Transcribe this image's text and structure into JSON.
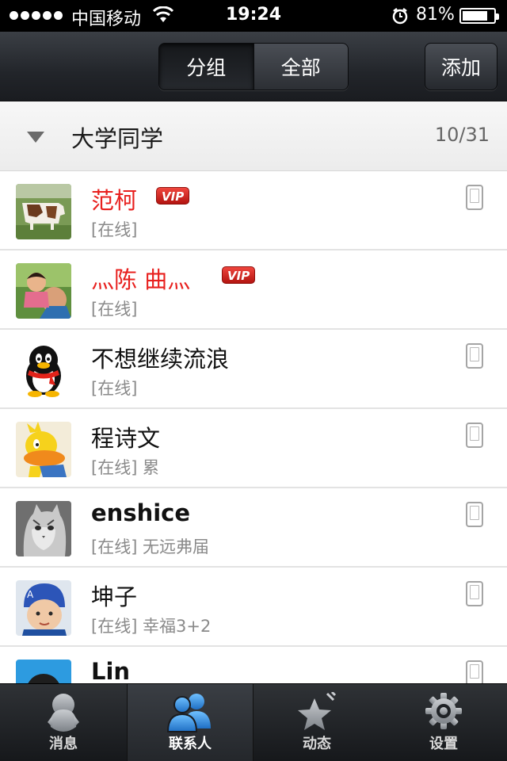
{
  "status_bar": {
    "carrier": "中国移动",
    "time": "19:24",
    "battery": "81%",
    "battery_level": 0.81
  },
  "nav": {
    "segments": [
      {
        "label": "分组",
        "selected": true
      },
      {
        "label": "全部",
        "selected": false
      }
    ],
    "add_label": "添加"
  },
  "group": {
    "name": "大学同学",
    "count": "10/31",
    "expanded": true
  },
  "contacts": [
    {
      "name": "范柯",
      "vip": true,
      "vip_label": "VIP",
      "status": "[在线]",
      "device": "phone-icon",
      "avatar": "cow-photo"
    },
    {
      "name": "灬陈  曲灬",
      "vip": true,
      "vip_label": "VIP",
      "status": "[在线]",
      "device": "",
      "avatar": "family-photo"
    },
    {
      "name": "不想继续流浪",
      "vip": false,
      "status": "[在线]",
      "device": "phone-icon",
      "avatar": "penguin-default"
    },
    {
      "name": "程诗文",
      "vip": false,
      "status": "[在线] 累",
      "device": "phone-icon",
      "avatar": "cartoon-duck"
    },
    {
      "name": "enshice",
      "vip": false,
      "status": "[在线] 无远弗届",
      "device": "phone-icon",
      "avatar": "cat-photo"
    },
    {
      "name": "坤子",
      "vip": false,
      "status": "[在线] 幸福3+2",
      "device": "phone-icon",
      "avatar": "baby-photo"
    },
    {
      "name": "Lin",
      "vip": false,
      "status": "",
      "device": "phone-icon",
      "avatar": "boy-cartoon"
    }
  ],
  "tabs": [
    {
      "label": "消息",
      "icon": "penguin-icon",
      "active": false
    },
    {
      "label": "联系人",
      "icon": "contacts-icon",
      "active": true
    },
    {
      "label": "动态",
      "icon": "star-icon",
      "active": false
    },
    {
      "label": "设置",
      "icon": "gear-icon",
      "active": false
    }
  ],
  "colors": {
    "vip_name": "#e8201e",
    "vip_badge": "#c81e18",
    "active_tab_icon": "#2f8de0"
  }
}
